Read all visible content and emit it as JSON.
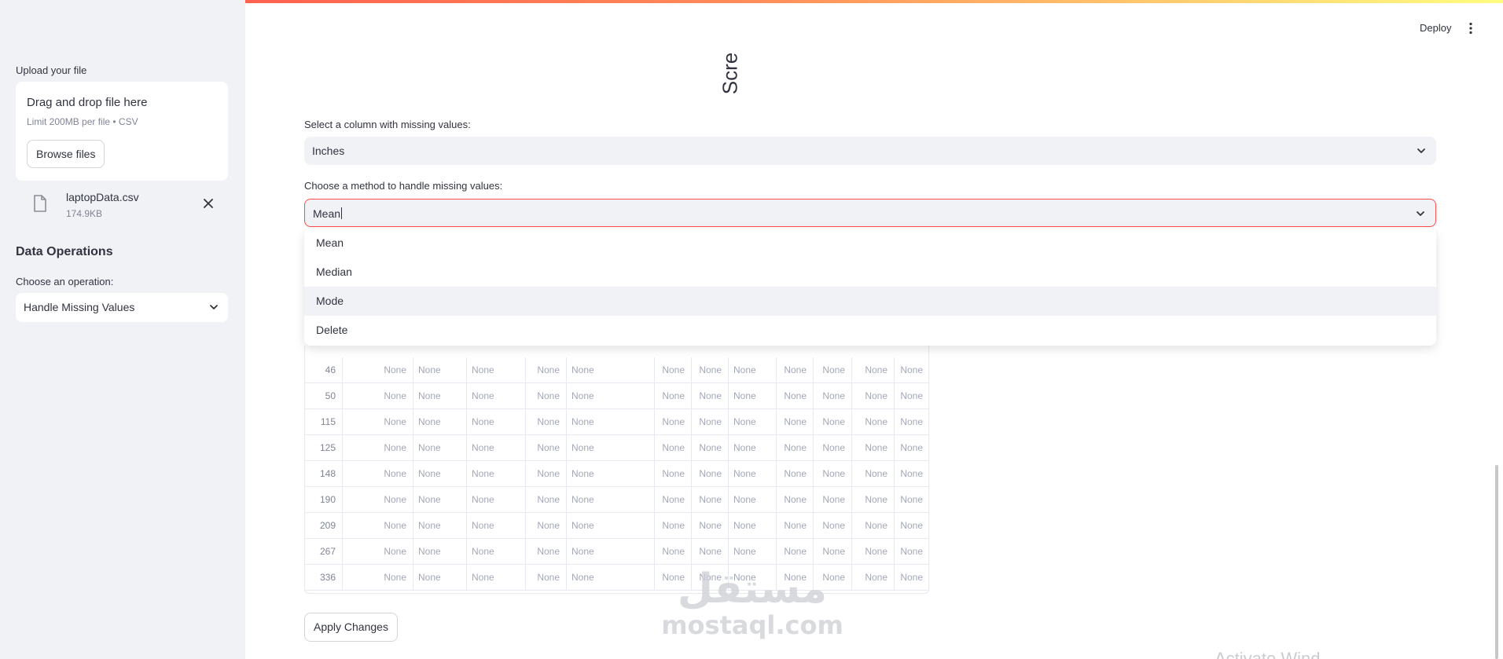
{
  "header": {
    "deploy_label": "Deploy",
    "menu_icon": "kebab-menu-icon"
  },
  "sidebar": {
    "upload_label": "Upload your file",
    "dropzone_title": "Drag and drop file here",
    "dropzone_limit": "Limit 200MB per file • CSV",
    "browse_label": "Browse files",
    "file": {
      "name": "laptopData.csv",
      "size": "174.9KB",
      "icon": "file-icon",
      "close_icon": "close-icon"
    },
    "section_title": "Data Operations",
    "operation_label": "Choose an operation:",
    "operation_value": "Handle Missing Values"
  },
  "main": {
    "rotated_title": "Scre",
    "column_label": "Select a column with missing values:",
    "column_value": "Inches",
    "method_label": "Choose a method to handle missing values:",
    "method_value": "Mean",
    "method_options": [
      "Mean",
      "Median",
      "Mode",
      "Delete"
    ],
    "highlighted_option": "Mode",
    "table": {
      "rows": [
        {
          "index": "46",
          "cells": [
            "None",
            "None",
            "None",
            "None",
            "None",
            "None",
            "None",
            "None",
            "None",
            "None",
            "None",
            "None"
          ]
        },
        {
          "index": "50",
          "cells": [
            "None",
            "None",
            "None",
            "None",
            "None",
            "None",
            "None",
            "None",
            "None",
            "None",
            "None",
            "None"
          ]
        },
        {
          "index": "115",
          "cells": [
            "None",
            "None",
            "None",
            "None",
            "None",
            "None",
            "None",
            "None",
            "None",
            "None",
            "None",
            "None"
          ]
        },
        {
          "index": "125",
          "cells": [
            "None",
            "None",
            "None",
            "None",
            "None",
            "None",
            "None",
            "None",
            "None",
            "None",
            "None",
            "None"
          ]
        },
        {
          "index": "148",
          "cells": [
            "None",
            "None",
            "None",
            "None",
            "None",
            "None",
            "None",
            "None",
            "None",
            "None",
            "None",
            "None"
          ]
        },
        {
          "index": "190",
          "cells": [
            "None",
            "None",
            "None",
            "None",
            "None",
            "None",
            "None",
            "None",
            "None",
            "None",
            "None",
            "None"
          ]
        },
        {
          "index": "209",
          "cells": [
            "None",
            "None",
            "None",
            "None",
            "None",
            "None",
            "None",
            "None",
            "None",
            "None",
            "None",
            "None"
          ]
        },
        {
          "index": "267",
          "cells": [
            "None",
            "None",
            "None",
            "None",
            "None",
            "None",
            "None",
            "None",
            "None",
            "None",
            "None",
            "None"
          ]
        },
        {
          "index": "336",
          "cells": [
            "None",
            "None",
            "None",
            "None",
            "None",
            "None",
            "None",
            "None",
            "None",
            "None",
            "None",
            "None"
          ]
        }
      ]
    },
    "apply_label": "Apply Changes"
  },
  "watermark": {
    "arabic": "مستقل",
    "latin": "mostaql.com"
  },
  "os_overlay": "Activate Wind",
  "colors": {
    "accent": "#ff4b4b",
    "sidebar_bg": "#f0f2f6",
    "text": "#31333f",
    "muted": "#808495"
  }
}
